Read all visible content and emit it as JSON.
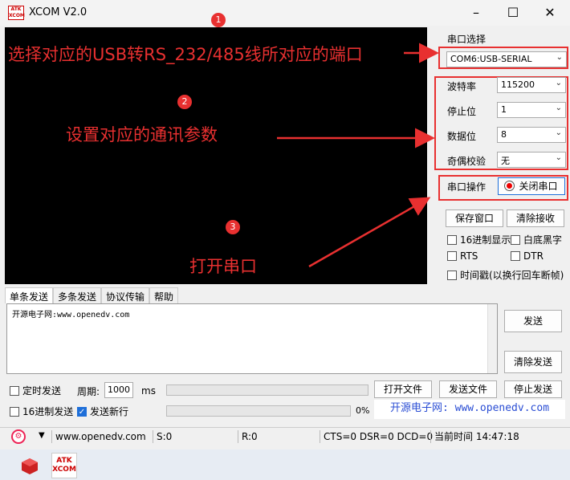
{
  "window": {
    "title": "XCOM V2.0",
    "logo_text": "ATK XCOM"
  },
  "annotations": {
    "a1": "选择对应的USB转RS_232/485线所对应的端口",
    "a2": "设置对应的通讯参数",
    "a3": "打开串口",
    "badge1": "1",
    "badge2": "2",
    "badge3": "3"
  },
  "panel": {
    "port_label": "串口选择",
    "port_value": "COM6:USB-SERIAL",
    "baud_label": "波特率",
    "baud_value": "115200",
    "stop_label": "停止位",
    "stop_value": "1",
    "data_label": "数据位",
    "data_value": "8",
    "parity_label": "奇偶校验",
    "parity_value": "无",
    "op_label": "串口操作",
    "close_port": "关闭串口",
    "save_window": "保存窗口",
    "clear_recv": "清除接收",
    "hex_display": "16进制显示",
    "white_black": "白底黑字",
    "rts": "RTS",
    "dtr": "DTR",
    "timestamp": "时间戳(以换行回车断帧)"
  },
  "tabs": [
    "单条发送",
    "多条发送",
    "协议传输",
    "帮助"
  ],
  "send": {
    "text": "开源电子网:www.openedv.com",
    "send_btn": "发送",
    "clear_send_btn": "清除发送",
    "timed_send": "定时发送",
    "period_label": "周期:",
    "period_value": "1000",
    "ms": "ms",
    "open_file": "打开文件",
    "send_file": "发送文件",
    "stop_send": "停止发送",
    "hex_send": "16进制发送",
    "send_newline": "发送新行",
    "progress": "0%",
    "site": "开源电子网: www.openedv.com"
  },
  "status": {
    "url": "www.openedv.com",
    "s": "S:0",
    "r": "R:0",
    "lines": "CTS=0 DSR=0 DCD=0",
    "time": "当前时间 14:47:18"
  },
  "colors": {
    "annotation": "#e83030",
    "accent": "#1e6fd9"
  }
}
